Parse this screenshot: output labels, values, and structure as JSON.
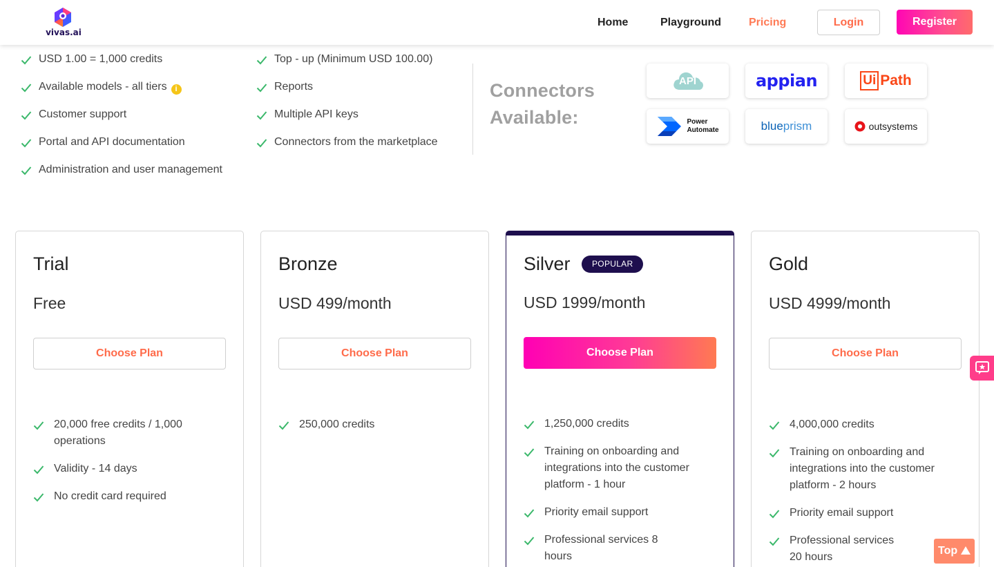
{
  "header": {
    "logo_text": "vivas.ai",
    "nav": {
      "home": "Home",
      "playground": "Playground",
      "pricing": "Pricing"
    },
    "login": "Login",
    "register": "Register"
  },
  "features": {
    "left": [
      "USD 1.00 = 1,000 credits",
      "Available models - all tiers",
      "Customer support",
      "Portal and API documentation",
      "Administration and user management"
    ],
    "right": [
      "Top - up (Minimum USD 100.00)",
      "Reports",
      "Multiple API keys",
      "Connectors from the marketplace"
    ],
    "info_icon": "i"
  },
  "connectors": {
    "title_line1": "Connectors",
    "title_line2": "Available:",
    "items": {
      "api": "API",
      "appian": "appian",
      "uipath_ui": "Ui",
      "uipath_path": "Path",
      "power_automate_1": "Power",
      "power_automate_2": "Automate",
      "blueprism_a": "blue",
      "blueprism_b": "prism",
      "outsystems": "outsystems"
    }
  },
  "plans": [
    {
      "name": "Trial",
      "price": "Free",
      "cta": "Choose Plan",
      "features": [
        "20,000 free credits / 1,000 operations",
        "Validity - 14 days",
        "No credit card required"
      ]
    },
    {
      "name": "Bronze",
      "price": "USD 499/month",
      "cta": "Choose Plan",
      "features": [
        "250,000 credits"
      ]
    },
    {
      "name": "Silver",
      "badge": "POPULAR",
      "price": "USD 1999/month",
      "cta": "Choose Plan",
      "features": [
        "1,250,000 credits",
        "Training on onboarding and integrations into the customer platform - 1 hour",
        "Priority email support",
        "Professional services 8 hours"
      ]
    },
    {
      "name": "Gold",
      "price": "USD 4999/month",
      "cta": "Choose Plan",
      "features": [
        "4,000,000 credits",
        "Training on onboarding and integrations into the customer platform - 2 hours",
        "Priority email support",
        "Professional services 20 hours"
      ]
    }
  ],
  "scroll_top": "Top",
  "colors": {
    "accent": "#ff6b4a",
    "brand_dark": "#1e0f4e",
    "check": "#3bb86b",
    "gradient_start": "#ff00b4",
    "gradient_end": "#ff7a52"
  }
}
